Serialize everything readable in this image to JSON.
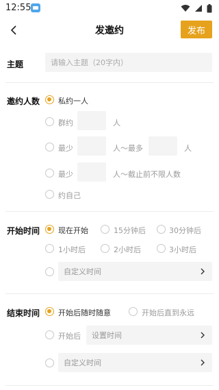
{
  "status": {
    "time": "12:55"
  },
  "nav": {
    "title": "发邀约",
    "publish": "发布"
  },
  "topic": {
    "label": "主题",
    "placeholder": "请输入主题（20字内）"
  },
  "invite": {
    "label": "邀约人数",
    "private": "私约一人",
    "group": "群约",
    "person": "人",
    "min": "最少",
    "range_max": "人～最多",
    "range_deadline": "人～截止前不限人数",
    "self": "约自己"
  },
  "start": {
    "label": "开始时间",
    "now": "现在开始",
    "m15": "15分钟后",
    "m30": "30分钟后",
    "h1": "1小时后",
    "h2": "2小时后",
    "h3": "3小时后",
    "custom": "自定义时间"
  },
  "end": {
    "label": "结束时间",
    "anytime": "开始后随时随意",
    "forever": "开始后直到永远",
    "after": "开始后",
    "set_time": "设置时间",
    "custom": "自定义时间"
  },
  "colors": {
    "accent": "#e6a21d"
  },
  "icons": [
    "back-arrow-icon",
    "wifi-icon",
    "signal-icon",
    "battery-icon",
    "chevron-right-icon",
    "app-notification-icon"
  ]
}
